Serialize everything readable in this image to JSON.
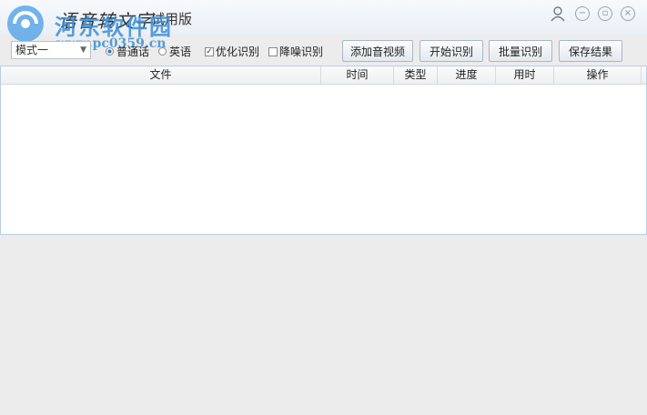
{
  "window": {
    "title": "语音转文字",
    "edition": "试用版",
    "watermark_name": "河东软件园",
    "watermark_url": "www.pc0359.cn",
    "controls": [
      "user-icon",
      "minimize-icon",
      "restore-icon",
      "close-icon"
    ]
  },
  "toolbar": {
    "mode_select": "模式一",
    "language_options": [
      "普通话",
      "英语"
    ],
    "language_selected": "普通话",
    "optimize_label": "优化识别",
    "optimize_checked": true,
    "denoise_label": "降噪识别",
    "denoise_checked": false,
    "buttons": {
      "add_media": "添加音视频",
      "start": "开始识别",
      "batch": "批量识别",
      "save": "保存结果"
    }
  },
  "table": {
    "columns": [
      "文件",
      "时间",
      "类型",
      "进度",
      "用时",
      "操作"
    ],
    "rows": []
  },
  "colors": {
    "accent": "#2a7ad3",
    "table_border": "#b9cde3",
    "background": "#ececec"
  }
}
